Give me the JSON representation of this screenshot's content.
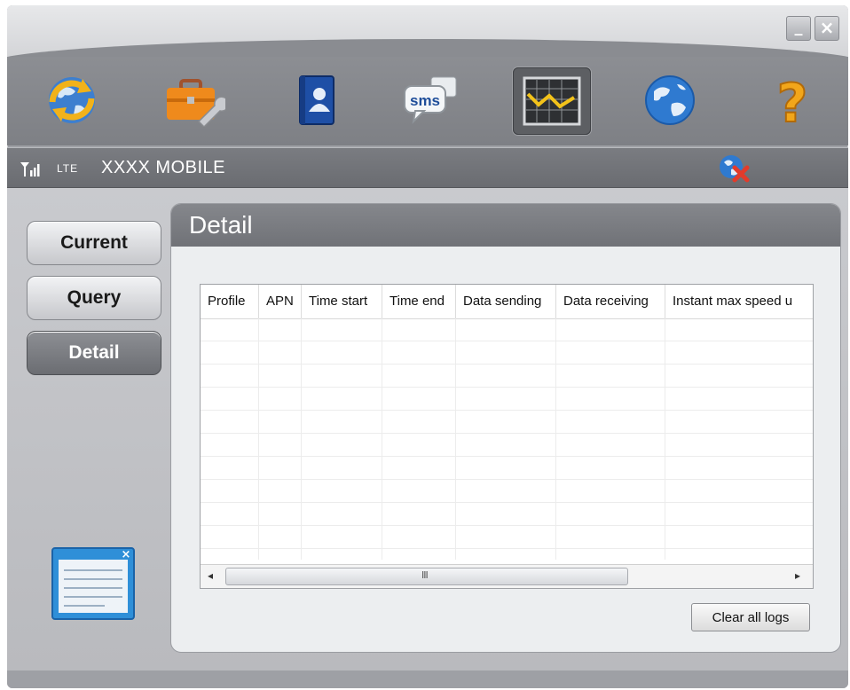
{
  "window": {
    "minimize_label": "_",
    "close_label": "×"
  },
  "toolbar": {
    "items": [
      {
        "name": "connect",
        "icon": "globe-refresh-icon"
      },
      {
        "name": "settings",
        "icon": "toolbox-wrench-icon"
      },
      {
        "name": "contacts",
        "icon": "contacts-book-icon"
      },
      {
        "name": "sms",
        "icon": "sms-bubble-icon",
        "label": "sms"
      },
      {
        "name": "statistics",
        "icon": "chart-line-icon",
        "active": true
      },
      {
        "name": "browser",
        "icon": "globe-icon"
      },
      {
        "name": "help",
        "icon": "question-icon",
        "label": "?"
      }
    ]
  },
  "status": {
    "signal_icon": "signal-bars-icon",
    "network_type": "LTE",
    "carrier": "XXXX MOBILE",
    "connection_icon": "disconnected-globe-icon"
  },
  "sidebar": {
    "buttons": [
      {
        "label": "Current",
        "active": false
      },
      {
        "label": "Query",
        "active": false
      },
      {
        "label": "Detail",
        "active": true
      }
    ],
    "widget_icon": "log-window-icon",
    "widget_close": "×"
  },
  "panel": {
    "title": "Detail",
    "table": {
      "columns": [
        "Profile",
        "APN",
        "Time start",
        "Time end",
        "Data sending",
        "Data receiving",
        "Instant max speed u"
      ],
      "rows": []
    },
    "scroll_grip": "III",
    "scroll_left": "◂",
    "scroll_right": "▸",
    "clear_button": "Clear all logs"
  },
  "colors": {
    "chrome": "#8c8e93",
    "panel_bg": "#eceef0",
    "active_button": "#6b6d72",
    "error_red": "#e23b2b"
  }
}
